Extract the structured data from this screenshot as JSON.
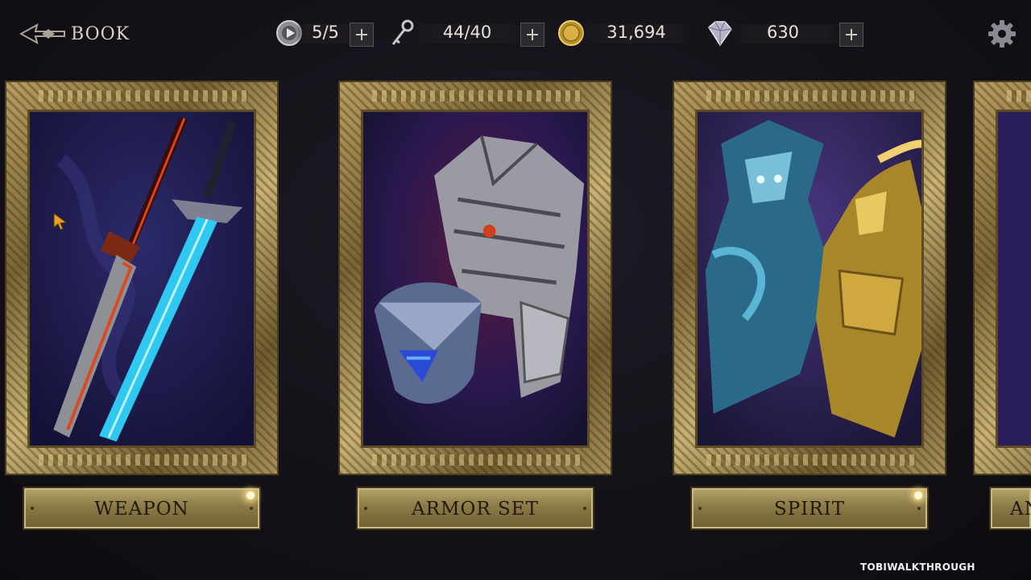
{
  "header": {
    "back_label": "BOOK",
    "back_icon": "back-arrow-icon"
  },
  "resources": [
    {
      "name": "stamina",
      "icon": "silver-coin-icon",
      "value": "5/5"
    },
    {
      "name": "keys",
      "icon": "key-icon",
      "value": "44/40"
    },
    {
      "name": "gold",
      "icon": "gold-coin-icon",
      "value": "31,694"
    },
    {
      "name": "gems",
      "icon": "gem-icon",
      "value": "630"
    }
  ],
  "settings_icon": "gear-icon",
  "cards": [
    {
      "label": "WEAPON",
      "art": "twin-swords",
      "notification": true
    },
    {
      "label": "ARMOR SET",
      "art": "armor-helmet",
      "notification": false
    },
    {
      "label": "SPIRIT",
      "art": "spirit-warriors",
      "notification": true
    },
    {
      "label": "AN",
      "art": "partial-card",
      "notification": false
    }
  ],
  "watermark": "TOBIWALKTHROUGH",
  "colors": {
    "background": "#121016",
    "gold_frame": "#b89e60",
    "plaque": "#8c7a46",
    "plaque_text": "#201a0f",
    "notification_dot": "#ffe08a"
  }
}
